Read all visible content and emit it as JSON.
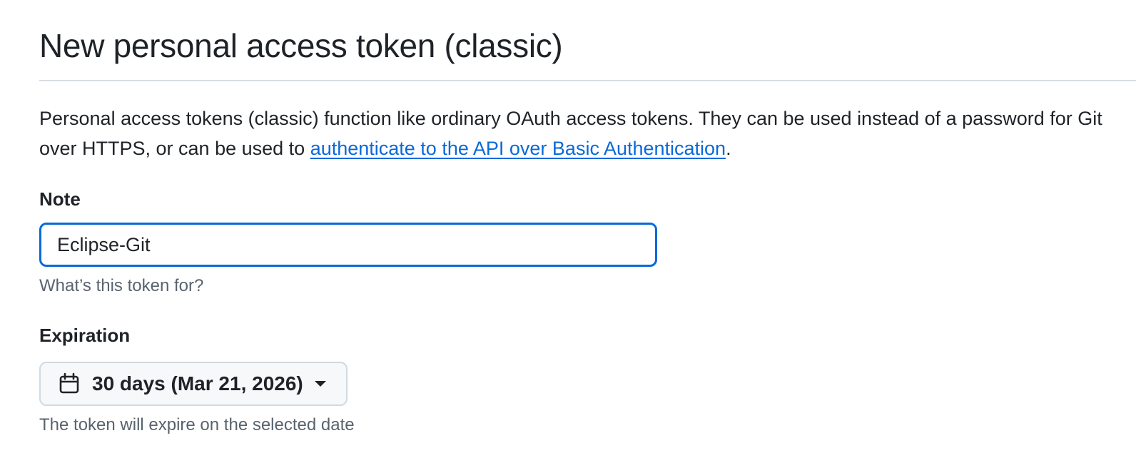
{
  "header": {
    "title": "New personal access token (classic)"
  },
  "description": {
    "text_before_link": "Personal access tokens (classic) function like ordinary OAuth access tokens. They can be used instead of a password for Git over HTTPS, or can be used to ",
    "link_text": "authenticate to the API over Basic Authentication",
    "text_after_link": "."
  },
  "note": {
    "label": "Note",
    "value": "Eclipse-Git",
    "hint": "What’s this token for?"
  },
  "expiration": {
    "label": "Expiration",
    "selected_value": "30 days (Mar 21, 2026)",
    "icon": "calendar-icon",
    "hint": "The token will expire on the selected date"
  },
  "colors": {
    "link": "#0969da",
    "focus_border": "#0969da",
    "muted_text": "#59636e",
    "text": "#1f2328"
  }
}
